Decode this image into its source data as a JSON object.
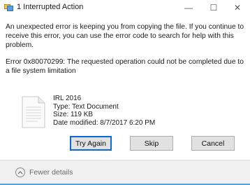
{
  "window": {
    "title": "1 Interrupted Action",
    "minimize_glyph": "—",
    "maximize_glyph": "☐",
    "close_glyph": "✕"
  },
  "dialog": {
    "message": "An unexpected error is keeping you from copying the file. If you continue to receive this error, you can use the error code to search for help with this problem.",
    "error": "Error 0x80070299: The requested operation could not be completed due to a file system limitation"
  },
  "file": {
    "icon": "text-document-icon",
    "name": "IRL 2016",
    "type": "Type: Text Document",
    "size": "Size: 119 KB",
    "date_modified": "Date modified: 8/7/2017 6:20 PM"
  },
  "buttons": {
    "try_again": "Try Again",
    "skip": "Skip",
    "cancel": "Cancel"
  },
  "footer": {
    "toggle_icon": "chevron-up-icon",
    "toggle_label": "Fewer details"
  },
  "colors": {
    "focus_border": "#0a6ad6",
    "accent_bar": "#5aa0d8",
    "footer_bg": "#f0f0f0",
    "button_bg": "#e1e1e1"
  }
}
